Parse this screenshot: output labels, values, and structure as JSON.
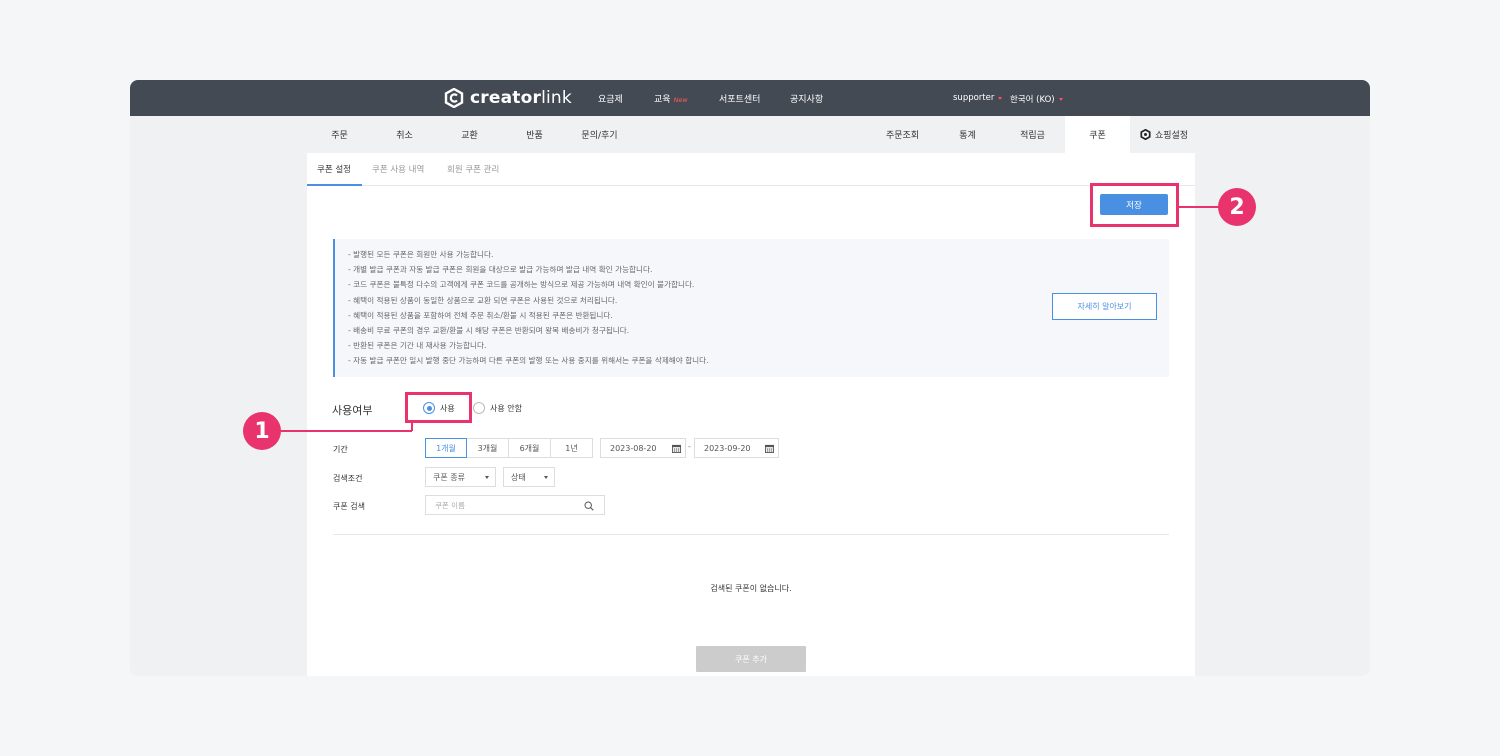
{
  "brand": {
    "name_bold": "creator",
    "name_light": "link"
  },
  "top_nav": {
    "pricing": "요금제",
    "education": "교육",
    "education_badge": "New",
    "support_center": "서포트센터",
    "notice": "공지사항"
  },
  "user_menu": {
    "user": "supporter",
    "language": "한국어 (KO)"
  },
  "main_tabs": {
    "order": "주문",
    "cancel": "취소",
    "exchange": "교환",
    "return": "반품",
    "inquiry": "문의/후기",
    "order_lookup": "주문조회",
    "stats": "통계",
    "points": "적립금",
    "coupon": "쿠폰",
    "shop_settings": "쇼핑설정"
  },
  "sub_tabs": {
    "coupon_settings": "쿠폰 설정",
    "coupon_usage": "쿠폰 사용 내역",
    "member_coupon": "회원 쿠폰 관리"
  },
  "save_label": "저장",
  "info_lines": [
    "- 발행된 모든 쿠폰은 회원만 사용 가능합니다.",
    "- 개별 발급 쿠폰과 자동 발급 쿠폰은 회원을 대상으로 발급 가능하며 발급 내역 확인 가능합니다.",
    "- 코드 쿠폰은 불특정 다수의 고객에게 쿠폰 코드를 공개하는 방식으로 제공 가능하며 내역 확인이 불가합니다.",
    "- 혜택이 적용된 상품이 동일한 상품으로 교환 되면 쿠폰은 사용된 것으로 처리됩니다.",
    "- 혜택이 적용된 상품을 포함하여 전체 주문 취소/환불 시 적용된 쿠폰은 반환됩니다.",
    "- 배송비 무료 쿠폰의 경우 교환/환불 시 해당 쿠폰은 반환되며 왕복 배송비가 청구됩니다.",
    "- 반환된 쿠폰은 기간 내 재사용 가능합니다.",
    "- 자동 발급 쿠폰만 일시 발행 중단 가능하며 다른 쿠폰의 발행 또는 사용 중지를 위해서는 쿠폰을 삭제해야 합니다."
  ],
  "detail_label": "자세히 알아보기",
  "usage": {
    "label": "사용여부",
    "use": "사용",
    "not_use": "사용 안함",
    "selected": "사용"
  },
  "period": {
    "label": "기간",
    "options": [
      "1개월",
      "3개월",
      "6개월",
      "1년"
    ],
    "selected": "1개월",
    "start": "2023-08-20",
    "separator": "-",
    "end": "2023-09-20"
  },
  "search_condition": {
    "label": "검색조건",
    "coupon_type": "쿠폰 종류",
    "status": "상태"
  },
  "coupon_search": {
    "label": "쿠폰 검색",
    "placeholder": "쿠폰 이름"
  },
  "empty_message": "검색된 쿠폰이 없습니다.",
  "add_coupon_label": "쿠폰 추가",
  "callouts": {
    "one": "1",
    "two": "2"
  },
  "colors": {
    "accent": "#4a90e2",
    "annotation": "#e8336d",
    "topbar": "#444a54"
  }
}
